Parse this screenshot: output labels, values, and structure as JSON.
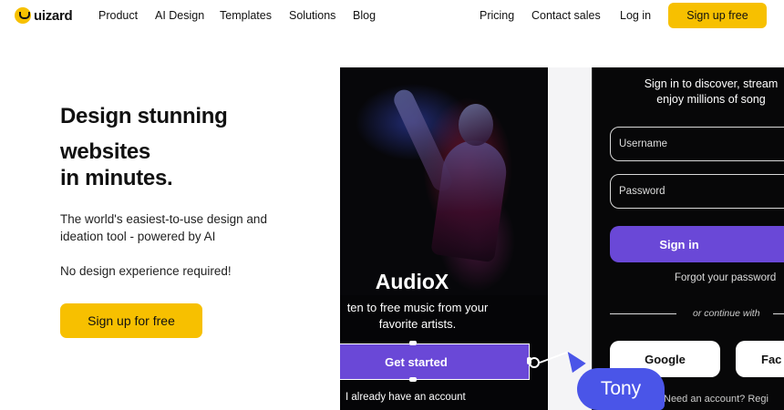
{
  "brand": {
    "name": "uizard"
  },
  "nav": {
    "items": [
      "Product",
      "AI Design",
      "Templates",
      "Solutions",
      "Blog"
    ],
    "pricing": "Pricing",
    "contact": "Contact sales",
    "login": "Log in",
    "signup": "Sign up free"
  },
  "hero": {
    "title_line1": "Design stunning",
    "title_line2": "websites",
    "title_line3": "in minutes.",
    "desc_line1": "The world's easiest-to-use design and",
    "desc_line2": "ideation tool - powered by AI",
    "note": "No design experience required!",
    "cta": "Sign up for free"
  },
  "mockup_app": {
    "name": "AudioX",
    "sub_line1": "ten to free music from your",
    "sub_line2": "favorite artists.",
    "cta": "Get started",
    "account": "I already have an account"
  },
  "mockup_signin": {
    "head_line1": "Sign in to discover, stream",
    "head_line2": "enjoy millions of song",
    "username_placeholder": "Username",
    "password_placeholder": "Password",
    "signin": "Sign in",
    "forgot": "Forgot your password",
    "or": "or continue with",
    "google": "Google",
    "facebook": "Fac",
    "need_account": "Need an account? Regi"
  },
  "cursor_label": "Tony",
  "colors": {
    "accent_yellow": "#f7c000",
    "purple": "#6a48d7",
    "cursor_blue": "#4a55e8"
  }
}
